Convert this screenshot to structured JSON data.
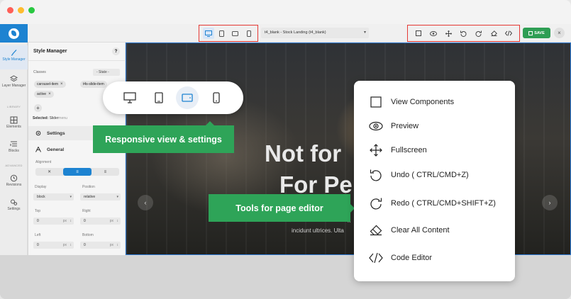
{
  "topbar": {
    "template_select": "t4_blank - Stock Landing (t4_blank)",
    "save_label": "SAVE",
    "close_label": "×",
    "device_icons": [
      "desktop-icon",
      "tablet-icon",
      "tablet-landscape-icon",
      "mobile-icon"
    ],
    "tool_icons": [
      "view-components-icon",
      "preview-icon",
      "fullscreen-icon",
      "undo-icon",
      "redo-icon",
      "eraser-icon",
      "code-icon"
    ]
  },
  "leftbar": {
    "items": [
      {
        "label": "Style Manager",
        "icon": "brush-icon"
      },
      {
        "label": "Layer Manager",
        "icon": "layers-icon"
      },
      {
        "label": "Elements",
        "icon": "grid-icon"
      },
      {
        "label": "Blocks",
        "icon": "blocks-icon"
      },
      {
        "label": "Revisions",
        "icon": "history-icon"
      },
      {
        "label": "Settings",
        "icon": "gears-icon"
      }
    ],
    "sections": {
      "library": "LIBRARY",
      "advanced": "ADVANCED"
    }
  },
  "panel": {
    "title": "Style Manager",
    "help": "?",
    "classes_label": "Classes",
    "state_select": "- State -",
    "tags": [
      "carousel-item",
      "t4s-slide-item",
      "active"
    ],
    "add": "+",
    "selected_label": "Selected:",
    "selected_value": "Slider",
    "selected_value2": "menu",
    "settings_section": "Settings",
    "general_section": "General",
    "alignment_label": "Alignment",
    "align_options": [
      "✕",
      "≡",
      "≡"
    ],
    "display_label": "Display",
    "display_value": "block",
    "position_label": "Position",
    "position_value": "relative",
    "top_label": "Top",
    "top_value": "0",
    "right_label": "Right",
    "right_value": "0",
    "left_label": "Left",
    "left_value": "0",
    "bottom_label": "Bottom",
    "bottom_value": "0",
    "unit": "px"
  },
  "canvas": {
    "hero_line1": "Not for",
    "hero_line2": "For Pe",
    "hero_sub1": "n",
    "hero_sub2": "incidunt ultrices. Ulta",
    "prev": "‹",
    "next": "›"
  },
  "callouts": {
    "responsive": "Responsive view & settings",
    "tools": "Tools for page editor"
  },
  "tools_menu": [
    {
      "label": "View Components",
      "icon": "view-components-icon"
    },
    {
      "label": "Preview",
      "icon": "preview-icon"
    },
    {
      "label": "Fullscreen",
      "icon": "fullscreen-icon"
    },
    {
      "label": "Undo ( CTRL/CMD+Z)",
      "icon": "undo-icon"
    },
    {
      "label": "Redo ( CTRL/CMD+SHIFT+Z)",
      "icon": "redo-icon"
    },
    {
      "label": "Clear All Content",
      "icon": "eraser-icon"
    },
    {
      "label": "Code Editor",
      "icon": "code-icon"
    }
  ],
  "colors": {
    "accent": "#1d83d1",
    "callout": "#2ea458",
    "save": "#2e9e54",
    "highlight_border": "#e53935"
  }
}
